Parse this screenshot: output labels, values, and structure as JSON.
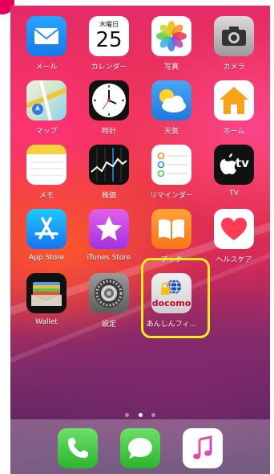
{
  "colors": {
    "highlight": "#f7ee1f",
    "marker": "#e4005a"
  },
  "calendar": {
    "weekday": "木曜日",
    "day": "25"
  },
  "tv_logo": "tv",
  "apps": {
    "mail": "メール",
    "calendar": "カレンダー",
    "photos": "写真",
    "camera": "カメラ",
    "maps": "マップ",
    "clock": "時計",
    "weather": "天気",
    "home": "ホーム",
    "notes": "メモ",
    "stocks": "株価",
    "reminders": "リマインダー",
    "tv": "TV",
    "appstore": "App Store",
    "itunes": "iTunes Store",
    "books": "ブック",
    "health": "ヘルスケア",
    "wallet": "Wallet",
    "settings": "設定",
    "anshin": "あんしんフィ…"
  },
  "anshin_logo": "docomo",
  "page_indicator": {
    "pages": 3,
    "current": 2
  },
  "dock": [
    "phone-icon",
    "messages-icon",
    "music-icon"
  ]
}
